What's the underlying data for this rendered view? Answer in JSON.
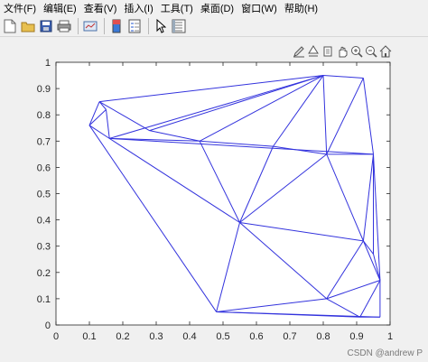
{
  "menu": {
    "file": "文件(F)",
    "edit": "编辑(E)",
    "view": "查看(V)",
    "insert": "插入(I)",
    "tools": "工具(T)",
    "desktop": "桌面(D)",
    "window": "窗口(W)",
    "help": "帮助(H)"
  },
  "toolbar": {
    "icons": [
      "new-file-icon",
      "open-file-icon",
      "save-icon",
      "print-icon",
      "link-plot-icon",
      "colorbar-icon",
      "legend-icon",
      "pointer-icon",
      "property-inspector-icon"
    ]
  },
  "axes_toolbar": {
    "icons": [
      "brush-icon",
      "data-tips-icon",
      "rotate-icon",
      "pan-icon",
      "zoom-in-icon",
      "zoom-out-icon",
      "home-icon"
    ]
  },
  "chart_data": {
    "type": "line",
    "xlim": [
      0,
      1
    ],
    "ylim": [
      0,
      1
    ],
    "xticks": [
      "0",
      "0.1",
      "0.2",
      "0.3",
      "0.4",
      "0.5",
      "0.6",
      "0.7",
      "0.8",
      "0.9",
      "1"
    ],
    "yticks": [
      "0",
      "0.1",
      "0.2",
      "0.3",
      "0.4",
      "0.5",
      "0.6",
      "0.7",
      "0.8",
      "0.9",
      "1"
    ],
    "line_color": "#3333dd",
    "points": [
      [
        0.1,
        0.76
      ],
      [
        0.13,
        0.85
      ],
      [
        0.15,
        0.82
      ],
      [
        0.16,
        0.71
      ],
      [
        0.28,
        0.74
      ],
      [
        0.43,
        0.7
      ],
      [
        0.48,
        0.05
      ],
      [
        0.55,
        0.39
      ],
      [
        0.65,
        0.68
      ],
      [
        0.8,
        0.95
      ],
      [
        0.81,
        0.65
      ],
      [
        0.81,
        0.1
      ],
      [
        0.92,
        0.94
      ],
      [
        0.92,
        0.32
      ],
      [
        0.95,
        0.65
      ],
      [
        0.95,
        0.27
      ],
      [
        0.91,
        0.03
      ],
      [
        0.97,
        0.17
      ],
      [
        0.97,
        0.03
      ]
    ],
    "edges": [
      [
        1,
        9
      ],
      [
        1,
        0
      ],
      [
        0,
        6
      ],
      [
        0,
        3
      ],
      [
        0,
        2
      ],
      [
        1,
        2
      ],
      [
        2,
        3
      ],
      [
        1,
        4
      ],
      [
        4,
        5
      ],
      [
        3,
        5
      ],
      [
        3,
        9
      ],
      [
        4,
        9
      ],
      [
        3,
        14
      ],
      [
        5,
        9
      ],
      [
        5,
        8
      ],
      [
        5,
        7
      ],
      [
        3,
        7
      ],
      [
        6,
        7
      ],
      [
        7,
        8
      ],
      [
        8,
        9
      ],
      [
        9,
        10
      ],
      [
        9,
        12
      ],
      [
        12,
        10
      ],
      [
        12,
        14
      ],
      [
        10,
        14
      ],
      [
        8,
        10
      ],
      [
        7,
        10
      ],
      [
        7,
        13
      ],
      [
        10,
        13
      ],
      [
        13,
        14
      ],
      [
        14,
        15
      ],
      [
        13,
        15
      ],
      [
        15,
        17
      ],
      [
        13,
        17
      ],
      [
        14,
        17
      ],
      [
        11,
        13
      ],
      [
        11,
        17
      ],
      [
        7,
        11
      ],
      [
        6,
        11
      ],
      [
        6,
        16
      ],
      [
        16,
        11
      ],
      [
        16,
        17
      ],
      [
        17,
        18
      ],
      [
        16,
        18
      ],
      [
        6,
        18
      ]
    ]
  },
  "watermark": "CSDN @andrew P"
}
